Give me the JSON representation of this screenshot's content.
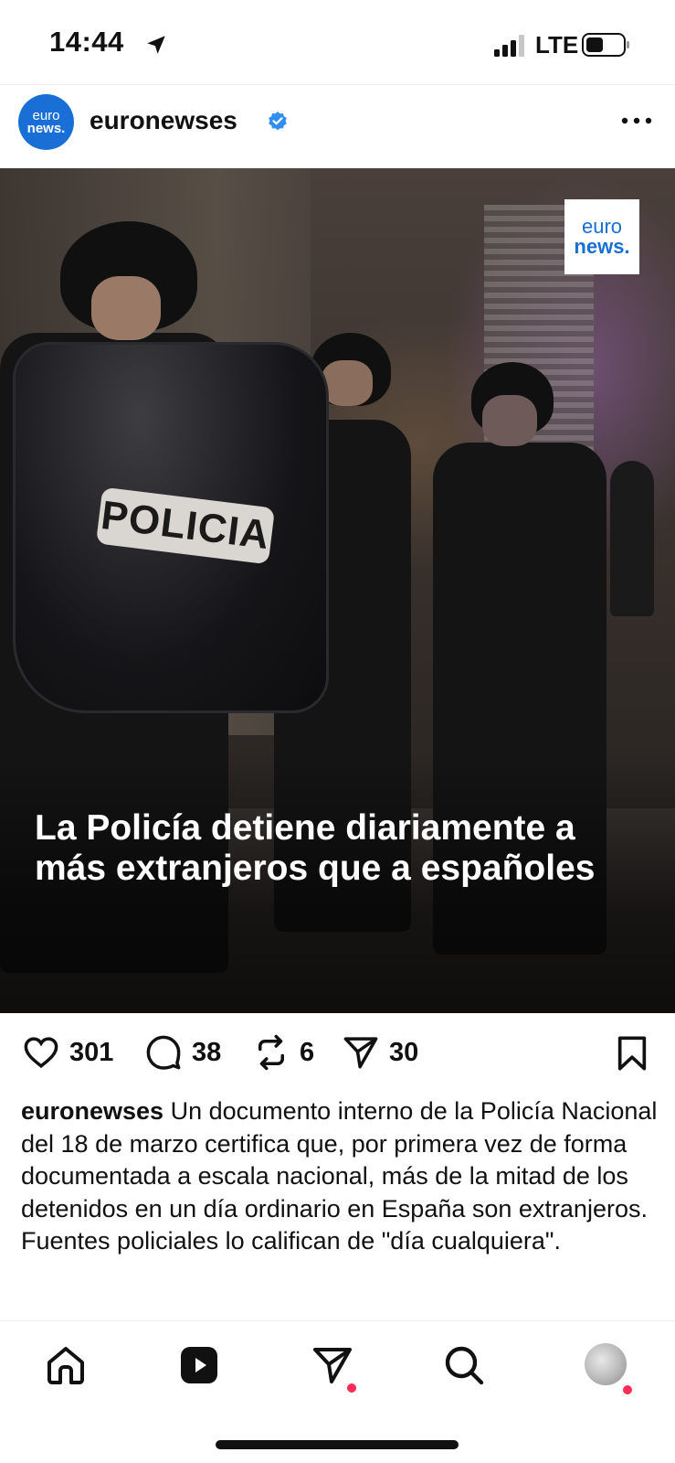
{
  "status_bar": {
    "time": "14:44",
    "network": "LTE",
    "icons": [
      "location-arrow-icon",
      "cellular-signal-icon",
      "battery-icon"
    ]
  },
  "post": {
    "account": {
      "username": "euronewses",
      "avatar_text_line1": "euro",
      "avatar_text_line2": "news.",
      "verified": true
    },
    "image": {
      "brand_line1": "euro",
      "brand_line2": "news.",
      "shield_text": "POLICIA",
      "headline": "La Policía detiene diariamente a más extranjeros que a españoles"
    },
    "actions": {
      "likes": "301",
      "comments": "38",
      "reposts": "6",
      "shares": "30"
    },
    "caption": {
      "username": "euronewses",
      "text": "Un documento interno de la Policía Nacional del 18 de marzo certifica que, por primera vez de forma documentada a escala nacional, más de la mitad de los detenidos en un día ordinario en España son extranjeros. Fuentes policiales lo califican de \"día cualquiera\"."
    }
  },
  "bottom_nav": {
    "items": [
      "home-icon",
      "reels-icon",
      "direct-messages-icon",
      "search-icon",
      "profile-avatar"
    ]
  },
  "colors": {
    "brand_blue": "#1a6fd6",
    "verified_blue": "#2f8ef0",
    "notification_dot": "#ff2d55"
  }
}
